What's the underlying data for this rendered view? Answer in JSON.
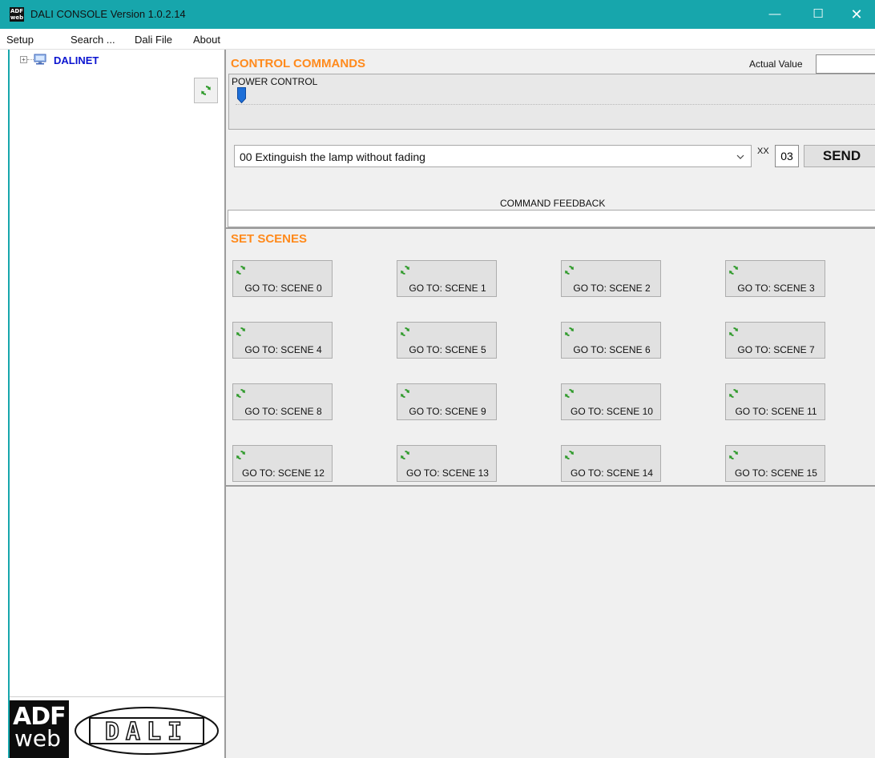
{
  "window": {
    "title": "DALI CONSOLE Version 1.0.2.14",
    "app_icon_text": "ADF web",
    "minimize_glyph": "—",
    "maximize_glyph": "☐",
    "close_glyph": "✕"
  },
  "menu": {
    "items": [
      "Setup",
      "Search ...",
      "Dali File",
      "About"
    ]
  },
  "tree": {
    "expander_glyph": "+",
    "root_label": "DALINET",
    "root_icon": "network-icon"
  },
  "logo": {
    "brand_top": "ADF",
    "brand_bottom": "web",
    "dali_text": "DALI"
  },
  "control": {
    "title": "CONTROL COMMANDS",
    "actual_value_label": "Actual Value",
    "actual_value": "",
    "power_control_label": "POWER CONTROL",
    "power_level_percent": 0,
    "command_selected": "00 Extinguish the lamp without fading",
    "xx_label": "XX",
    "xx_value": "03",
    "send_label": "SEND",
    "feedback_label": "COMMAND FEEDBACK",
    "feedback_value": ""
  },
  "scenes": {
    "title": "SET SCENES",
    "buttons": [
      "GO TO: SCENE 0",
      "GO TO: SCENE 1",
      "GO TO: SCENE 2",
      "GO TO: SCENE 3",
      "GO TO: SCENE 4",
      "GO TO: SCENE 5",
      "GO TO: SCENE 6",
      "GO TO: SCENE 7",
      "GO TO: SCENE 8",
      "GO TO: SCENE 9",
      "GO TO: SCENE 10",
      "GO TO: SCENE 11",
      "GO TO: SCENE 12",
      "GO TO: SCENE 13",
      "GO TO: SCENE 14",
      "GO TO: SCENE 15"
    ]
  },
  "colors": {
    "titlebar": "#17a6ac",
    "section_title": "#ff8a1c",
    "tree_label": "#0b14d0",
    "refresh_icon": "#2e9a2a"
  }
}
